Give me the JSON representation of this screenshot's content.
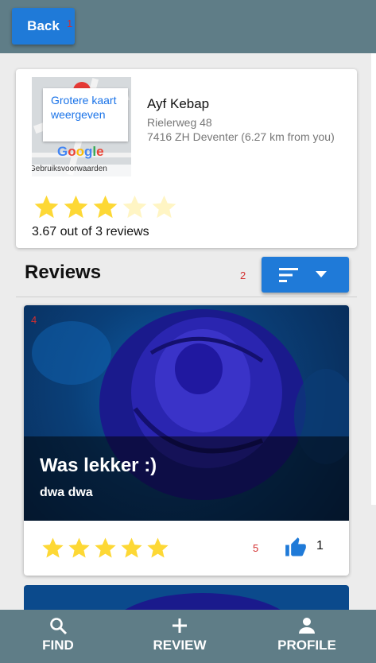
{
  "header": {
    "back_label": "Back"
  },
  "markers": [
    "1",
    "2",
    "4",
    "5"
  ],
  "restaurant": {
    "name": "Ayf Kebap",
    "address_line1": "Rielerweg 48",
    "address_line2": "7416 ZH Deventer (6.27 km from you)",
    "rating_text": "3.67 out of 3 reviews",
    "rating_stars": 3.67,
    "map": {
      "popup_link": "Grotere kaart weergeven",
      "logo": "Google",
      "terms": "Gebruiksvoorwaarden"
    }
  },
  "reviews_section": {
    "title": "Reviews",
    "sort_icons": [
      "sort-lines-icon",
      "caret-down-icon"
    ]
  },
  "reviews": [
    {
      "title": "Was lekker :)",
      "subtitle": "dwa dwa",
      "stars": 5,
      "likes": "1"
    }
  ],
  "nav": [
    {
      "label": "FIND",
      "icon": "search-icon"
    },
    {
      "label": "REVIEW",
      "icon": "plus-icon"
    },
    {
      "label": "PROFILE",
      "icon": "person-icon"
    }
  ],
  "colors": {
    "primary": "#1f7ad8",
    "bar": "#5f7d87",
    "star": "#fdd835",
    "marker": "#d32f2f"
  }
}
